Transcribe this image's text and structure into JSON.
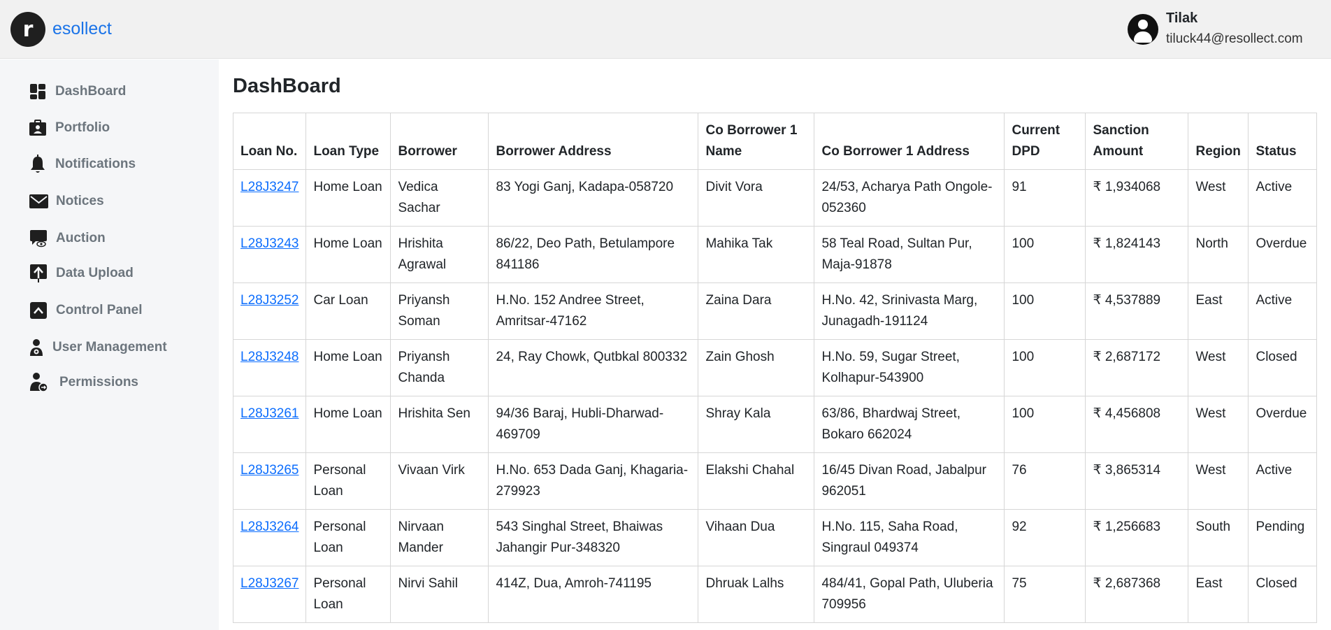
{
  "brand": {
    "logo_letter": "r",
    "name": "esollect"
  },
  "user": {
    "name": "Tilak",
    "email": "tiluck44@resollect.com"
  },
  "sidebar": {
    "items": [
      {
        "label": "DashBoard",
        "icon": "dashboard-icon"
      },
      {
        "label": "Portfolio",
        "icon": "portfolio-icon"
      },
      {
        "label": "Notifications",
        "icon": "bell-icon"
      },
      {
        "label": "Notices",
        "icon": "envelope-icon"
      },
      {
        "label": "Auction",
        "icon": "auction-icon"
      },
      {
        "label": "Data Upload",
        "icon": "upload-icon"
      },
      {
        "label": "Control Panel",
        "icon": "control-panel-icon"
      },
      {
        "label": "User Management",
        "icon": "user-management-icon"
      },
      {
        "label": "Permissions",
        "icon": "permissions-icon"
      }
    ]
  },
  "main": {
    "title": "DashBoard",
    "table": {
      "headers": [
        "Loan No.",
        "Loan Type",
        "Borrower",
        "Borrower Address",
        "Co Borrower 1 Name",
        "Co Borrower 1 Address",
        "Current DPD",
        "Sanction Amount",
        "Region",
        "Status"
      ],
      "rows": [
        [
          "L28J3247",
          "Home Loan",
          "Vedica Sachar",
          "83 Yogi Ganj, Kadapa-058720",
          "Divit Vora",
          "24/53, Acharya Path Ongole-052360",
          "91",
          "₹ 1,934068",
          "West",
          "Active"
        ],
        [
          "L28J3243",
          "Home Loan",
          "Hrishita Agrawal",
          "86/22, Deo Path, Betulampore 841186",
          "Mahika Tak",
          "58 Teal Road, Sultan Pur, Maja-91878",
          "100",
          "₹ 1,824143",
          "North",
          "Overdue"
        ],
        [
          "L28J3252",
          "Car Loan",
          "Priyansh Soman",
          "H.No. 152 Andree Street, Amritsar-47162",
          "Zaina Dara",
          "H.No. 42, Srinivasta Marg, Junagadh-191124",
          "100",
          "₹ 4,537889",
          "East",
          "Active"
        ],
        [
          "L28J3248",
          "Home Loan",
          "Priyansh Chanda",
          "24, Ray Chowk, Qutbkal 800332",
          "Zain Ghosh",
          "H.No. 59, Sugar Street, Kolhapur-543900",
          "100",
          "₹ 2,687172",
          "West",
          "Closed"
        ],
        [
          "L28J3261",
          "Home Loan",
          "Hrishita Sen",
          "94/36 Baraj, Hubli-Dharwad-469709",
          "Shray Kala",
          "63/86, Bhardwaj Street, Bokaro 662024",
          "100",
          "₹ 4,456808",
          "West",
          "Overdue"
        ],
        [
          "L28J3265",
          "Personal Loan",
          "Vivaan Virk",
          "H.No. 653 Dada Ganj, Khagaria-279923",
          "Elakshi Chahal",
          "16/45 Divan Road, Jabalpur 962051",
          "76",
          "₹ 3,865314",
          "West",
          "Active"
        ],
        [
          "L28J3264",
          "Personal Loan",
          "Nirvaan Mander",
          "543 Singhal Street, Bhaiwas Jahangir Pur-348320",
          "Vihaan Dua",
          "H.No. 115, Saha Road, Singraul 049374",
          "92",
          "₹ 1,256683",
          "South",
          "Pending"
        ],
        [
          "L28J3267",
          "Personal Loan",
          "Nirvi Sahil",
          "414Z, Dua, Amroh-741195",
          "Dhruak Lalhs",
          "484/41, Gopal Path, Uluberia 709956",
          "75",
          "₹ 2,687368",
          "East",
          "Closed"
        ]
      ]
    }
  },
  "colors": {
    "brand": "#1a73e8",
    "link": "#0d6efd",
    "topbar_bg": "#f1f1f1",
    "sidebar_bg": "#f5f6f8",
    "nav_text": "#6c757d"
  }
}
